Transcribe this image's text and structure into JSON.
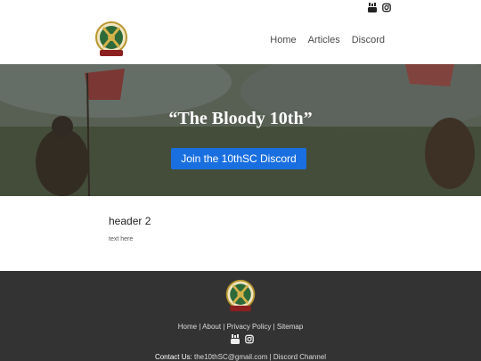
{
  "topbar": {
    "icons": [
      "youtube-icon",
      "instagram-icon"
    ]
  },
  "nav": {
    "items": [
      "Home",
      "Articles",
      "Discord"
    ]
  },
  "hero": {
    "title": "“The Bloody 10th”",
    "button_label": "Join the 10thSC Discord"
  },
  "content": {
    "heading": "header 2",
    "body": "text here"
  },
  "footer": {
    "links": [
      "Home",
      "About",
      "Privacy Policy",
      "Sitemap"
    ],
    "separator": " | ",
    "contact_label": "Contact Us:",
    "contact_email": "the10thSC@gmail.com",
    "contact_sep": " | ",
    "discord_label": "Discord Channel"
  },
  "colors": {
    "accent": "#1a6fe0",
    "footer_bg": "#333333"
  }
}
